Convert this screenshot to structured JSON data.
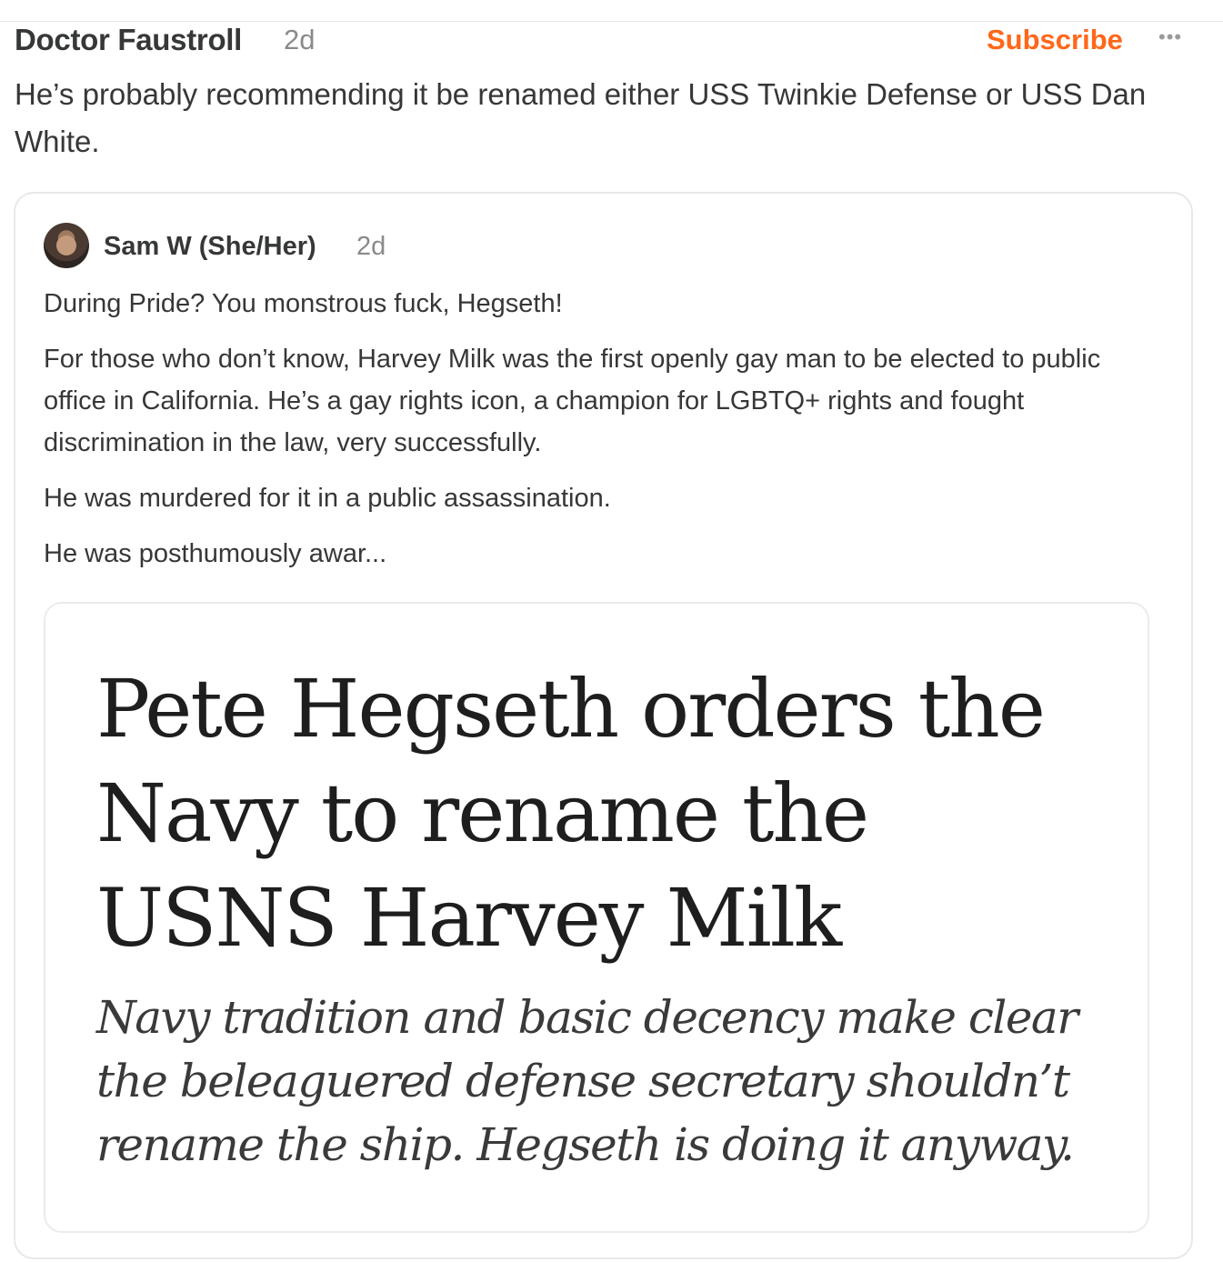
{
  "comment": {
    "author": "Doctor Faustroll",
    "time": "2d",
    "subscribe_label": "Subscribe",
    "more_label": "•••",
    "body": "He’s probably recommending it be renamed either USS Twinkie Defense or USS Dan White."
  },
  "quoted_note": {
    "author": "Sam W (She/Her)",
    "time": "2d",
    "paragraphs": [
      "During Pride? You monstrous fuck, Hegseth!",
      "For those who don’t know, Harvey Milk was the first openly gay man to be elected to public office in California. He’s a gay rights icon, a champion for LGBTQ+ rights and fought discrimination in the law, very successfully.",
      "He was murdered for it in a public assassination.",
      "He was posthumously awar..."
    ],
    "image": {
      "headline": "Pete Hegseth orders the Navy to rename the USNS Harvey Milk",
      "dek": "Navy tradition and basic decency make clear the beleaguered defense secretary shouldn’t rename the ship. Hegseth is doing it anyway."
    }
  }
}
